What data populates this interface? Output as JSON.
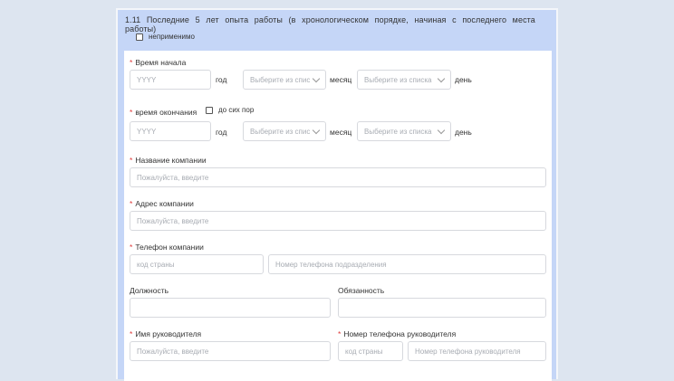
{
  "section": {
    "title": "1.11 Последние 5 лет опыта работы (в хронологическом порядке, начиная с последнего места работы)",
    "not_applicable": "неприменимо"
  },
  "form": {
    "start_time": {
      "label": "Время начала",
      "year_placeholder": "YYYY",
      "year_unit": "год",
      "month_placeholder": "Выберите из списка",
      "month_unit": "месяц",
      "day_placeholder": "Выберите из списка",
      "day_unit": "день"
    },
    "end_time": {
      "label": "время окончания",
      "until_now": "до сих пор",
      "year_placeholder": "YYYY",
      "year_unit": "год",
      "month_placeholder": "Выберите из списка",
      "month_unit": "месяц",
      "day_placeholder": "Выберите из списка",
      "day_unit": "день"
    },
    "company_name": {
      "label": "Название компании",
      "placeholder": "Пожалуйста, введите"
    },
    "company_address": {
      "label": "Адрес компании",
      "placeholder": "Пожалуйста, введите"
    },
    "company_phone": {
      "label": "Телефон компании",
      "country_code_placeholder": "код страны",
      "number_placeholder": "Номер телефона подразделения"
    },
    "position": {
      "label": "Должность"
    },
    "duty": {
      "label": "Обязанность"
    },
    "manager_name": {
      "label": "Имя руководителя",
      "placeholder": "Пожалуйста, введите"
    },
    "manager_phone": {
      "label": "Номер телефона руководителя",
      "country_code_placeholder": "код страны",
      "number_placeholder": "Номер телефона руководителя"
    }
  },
  "colors": {
    "panel": "#c5d6f7",
    "required": "#e03a3a",
    "border": "#d7d9de"
  }
}
